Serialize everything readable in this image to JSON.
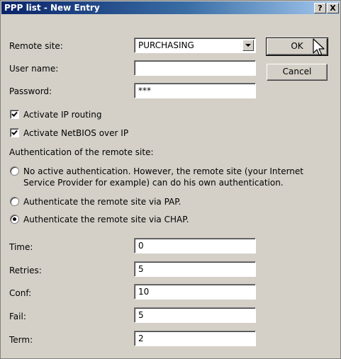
{
  "window": {
    "title": "PPP list - New Entry",
    "help_glyph": "?",
    "close_glyph": "X"
  },
  "fields": {
    "remote_site": {
      "label": "Remote site:",
      "value": "PURCHASING"
    },
    "user_name": {
      "label": "User name:",
      "value": ""
    },
    "password": {
      "label": "Password:",
      "value": "***"
    }
  },
  "buttons": {
    "ok": "OK",
    "cancel": "Cancel"
  },
  "checkboxes": [
    {
      "label": "Activate IP routing",
      "checked": true
    },
    {
      "label": "Activate NetBIOS over IP",
      "checked": true
    }
  ],
  "auth": {
    "heading": "Authentication of the remote site:",
    "options": [
      {
        "line1": "No active authentication. However, the remote site (your Internet",
        "line2": "Service Provider for example) can do his own authentication.",
        "selected": false
      },
      {
        "line1": "Authenticate the remote site via PAP.",
        "selected": false
      },
      {
        "line1": "Authenticate the remote site via CHAP.",
        "selected": true
      }
    ]
  },
  "timing": [
    {
      "label": "Time:",
      "value": "0"
    },
    {
      "label": "Retries:",
      "value": "5"
    },
    {
      "label": "Conf:",
      "value": "10"
    },
    {
      "label": "Fail:",
      "value": "5"
    },
    {
      "label": "Term:",
      "value": "2"
    }
  ]
}
